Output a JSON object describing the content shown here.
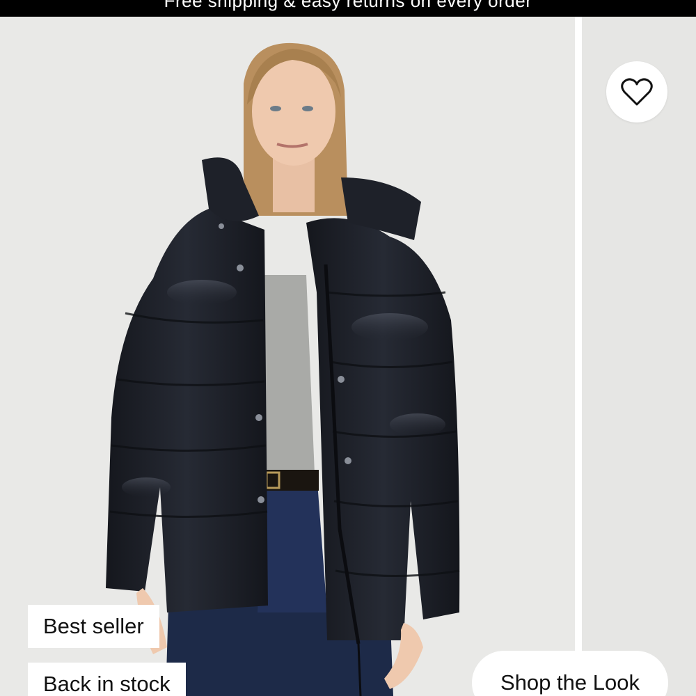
{
  "promo": {
    "text": "Free shipping & easy returns on every order"
  },
  "product_card": {
    "image_alt": "Model wearing black glossy hooded puffer jacket",
    "wishlist_icon": "heart-outline-icon",
    "badges": [
      "Best seller",
      "Back in stock"
    ],
    "shop_the_look_label": "Shop the Look"
  },
  "colors": {
    "promo_bg": "#000000",
    "photo_bg": "#e9e9e7",
    "jacket": "#1c1f27",
    "badge_bg": "#ffffff"
  }
}
